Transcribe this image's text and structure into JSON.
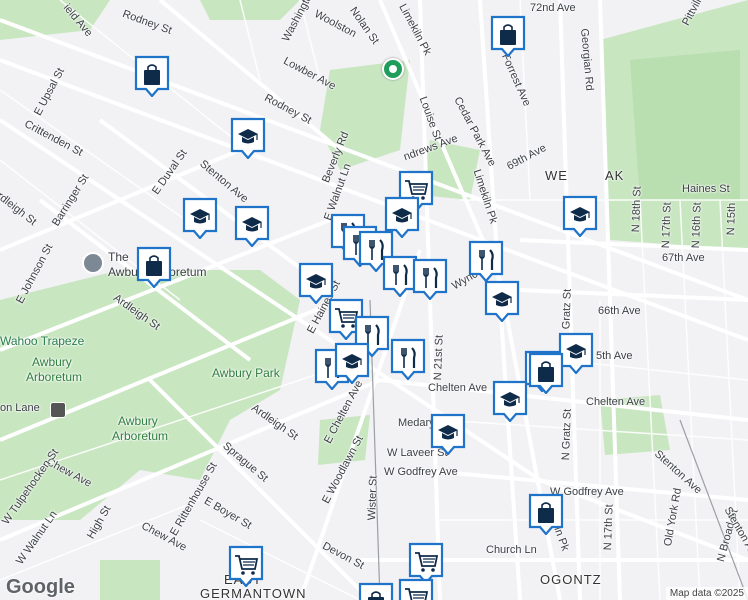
{
  "colors": {
    "marker": "#1f73c9",
    "marker_icon": "#0f2b4a",
    "park": "#c8e6c0",
    "road": "#ffffff",
    "land": "#f2f1f4"
  },
  "labels": {
    "rodney_top": "Rodney St",
    "washington": "Washington",
    "woolston": "Woolston",
    "nolan": "Nolan St",
    "limekiln_top": "Limekiln Pk",
    "ave_72": "72nd Ave",
    "field_ave": "ield Ave",
    "lowber": "Lowber Ave",
    "forrest": "Forrest Ave",
    "georgian": "Georgian Rd",
    "pittville": "Pittville",
    "upsal": "E Upsal St",
    "crittenden": "Crittenden St",
    "rodney_mid": "Rodney St",
    "louise": "Louise St",
    "cedar_park": "Cedar Park Ave",
    "stenton_w": "Stenton Ave",
    "duval": "E Duval St",
    "beverly": "Beverly Rd",
    "andrews": "ndrews Ave",
    "ave_69": "69th Ave",
    "west_oak": "WE",
    "west_oak2": "AK",
    "haines": "Haines St",
    "ardleigh_w": "rdleigh St",
    "barringer": "Barringer St",
    "walnut_ln": "E Walnut Ln",
    "limekiln_mid": "Limekiln Pk",
    "n18": "N 18th St",
    "n17": "N 17th St",
    "n16": "N 16th St",
    "n15": "N 15th",
    "ave_67": "67th Ave",
    "johnson": "E Johnson St",
    "arboretum_the": "The",
    "arboretum_title": "Awbury Arboretum",
    "e_haines": "E Haines St",
    "wyncote": "Wyncote",
    "ave_66": "66th Ave",
    "ardleigh_mid": "Ardleigh St",
    "wahoo": "Wahoo Trapeze",
    "awbury_arb": "Awbury",
    "awbury_arb2": "Arboretum",
    "awbury_park": "Awbury Park",
    "ave_65": "5th Ave",
    "chelten_e": "Chelten Ave",
    "chelten_mid": "Chelten Ave",
    "e_chelten": "E Chelten Ave",
    "n21": "N 21st St",
    "gratz": "N Gratz St",
    "gratz2": "N Gratz St",
    "washington_lane": "on Lane",
    "awbury_arb3": "Awbury",
    "awbury_arb4": "Arboretum",
    "ardleigh_s": "Ardleigh St",
    "medary": "Medary",
    "laveer": "W Laveer St",
    "godfrey_w": "W Godfrey Ave",
    "godfrey_e": "W Godfrey Ave",
    "stenton_e": "Stenton Ave",
    "sprague": "Sprague St",
    "woodlawn": "E Woodlawn St",
    "chew_w": "Chew Ave",
    "tulpehocken": "W Tulpehocken St",
    "rittenhouse": "E Rittenhouse St",
    "boyer": "E Boyer St",
    "chew_s": "Chew Ave",
    "wister": "Wister St",
    "ok_pk": "kiln Pk",
    "n17_s": "N 17th St",
    "old_york": "Old York Rd",
    "n_broad": "N Broad St",
    "w_walnut": "W Walnut Ln",
    "high": "High St",
    "devon": "Devon St",
    "church": "Church Ln",
    "east_germantown": "EAST",
    "germantown": "GERMANTOWN",
    "ogontz": "OGONTZ",
    "e_stenton_s": "Stenton Ave"
  },
  "attribution": {
    "logo": "Google",
    "map_data": "Map data ©2025"
  },
  "markers": [
    {
      "type": "shopping-bag"
    },
    {
      "type": "shopping-bag"
    },
    {
      "type": "school"
    },
    {
      "type": "school"
    },
    {
      "type": "school"
    },
    {
      "type": "shopping-bag"
    },
    {
      "type": "shopping-cart"
    },
    {
      "type": "school"
    },
    {
      "type": "restaurant"
    },
    {
      "type": "restaurant"
    },
    {
      "type": "restaurant"
    },
    {
      "type": "restaurant"
    },
    {
      "type": "restaurant"
    },
    {
      "type": "restaurant"
    },
    {
      "type": "school"
    },
    {
      "type": "shopping-cart"
    },
    {
      "type": "school"
    },
    {
      "type": "restaurant"
    },
    {
      "type": "restaurant"
    },
    {
      "type": "restaurant"
    },
    {
      "type": "school"
    },
    {
      "type": "school"
    },
    {
      "type": "shopping-cart"
    },
    {
      "type": "school"
    },
    {
      "type": "shopping-bag"
    },
    {
      "type": "school"
    },
    {
      "type": "school"
    },
    {
      "type": "shopping-bag"
    },
    {
      "type": "shopping-cart"
    },
    {
      "type": "shopping-cart"
    },
    {
      "type": "shopping-cart"
    },
    {
      "type": "shopping-bag"
    }
  ]
}
